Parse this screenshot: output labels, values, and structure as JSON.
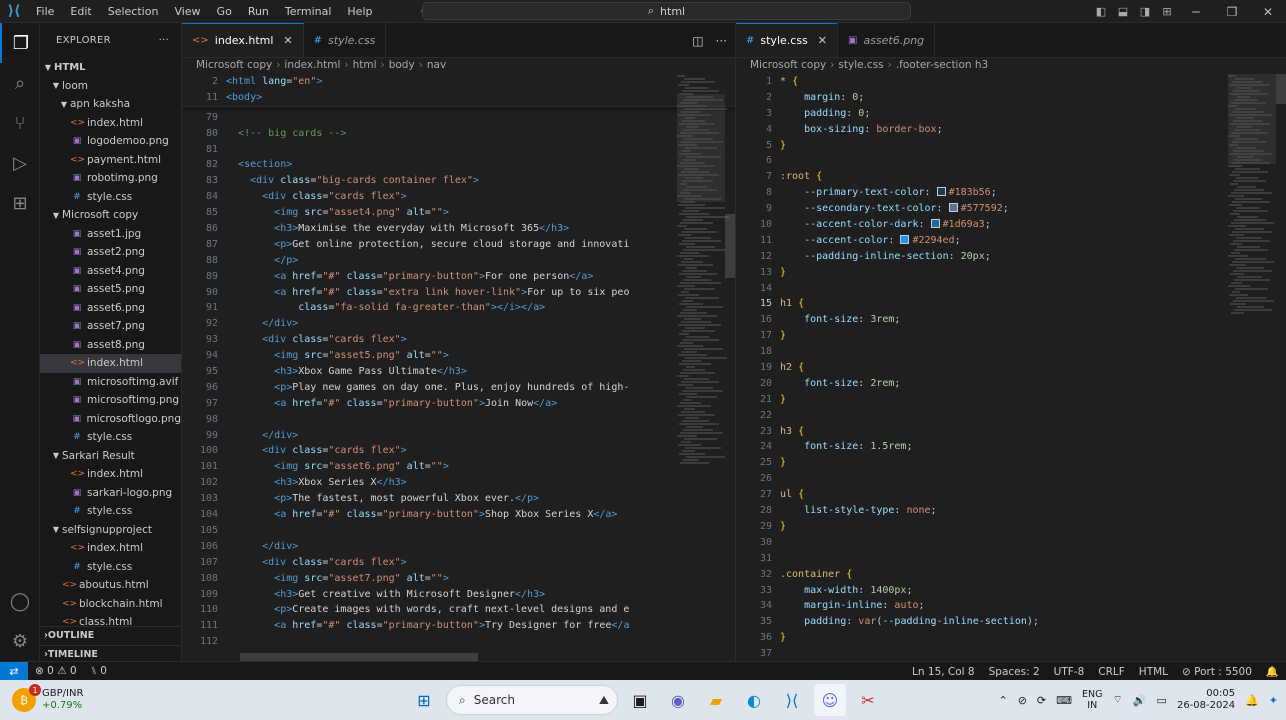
{
  "titlebar": {
    "menu": [
      "File",
      "Edit",
      "Selection",
      "View",
      "Go",
      "Run",
      "Terminal",
      "Help"
    ],
    "search_text": "html"
  },
  "explorer": {
    "title": "EXPLORER",
    "root": "HTML",
    "items": [
      {
        "label": "loom",
        "type": "folder",
        "depth": 1,
        "open": true
      },
      {
        "label": "apn kaksha",
        "type": "folder",
        "depth": 2,
        "open": true
      },
      {
        "label": "index.html",
        "type": "html",
        "depth": 2
      },
      {
        "label": "logodemoo.png",
        "type": "img",
        "depth": 2
      },
      {
        "label": "payment.html",
        "type": "html",
        "depth": 2
      },
      {
        "label": "robotimg.png",
        "type": "img",
        "depth": 2
      },
      {
        "label": "style.css",
        "type": "css",
        "depth": 2
      },
      {
        "label": "Microsoft copy",
        "type": "folder",
        "depth": 1,
        "open": true
      },
      {
        "label": "asset1.jpg",
        "type": "img",
        "depth": 2
      },
      {
        "label": "asset2.png",
        "type": "img",
        "depth": 2
      },
      {
        "label": "asset4.png",
        "type": "img",
        "depth": 2
      },
      {
        "label": "asset5.png",
        "type": "img",
        "depth": 2
      },
      {
        "label": "asset6.png",
        "type": "img",
        "depth": 2
      },
      {
        "label": "asset7.png",
        "type": "img",
        "depth": 2
      },
      {
        "label": "asset8.png",
        "type": "img",
        "depth": 2
      },
      {
        "label": "index.html",
        "type": "html",
        "depth": 2,
        "selected": true
      },
      {
        "label": "microsoftimg.avif",
        "type": "img",
        "depth": 2
      },
      {
        "label": "microsoftimg.png",
        "type": "img",
        "depth": 2
      },
      {
        "label": "microsoftlogo.png",
        "type": "img",
        "depth": 2
      },
      {
        "label": "style.css",
        "type": "css",
        "depth": 2
      },
      {
        "label": "Sarkari Result",
        "type": "folder",
        "depth": 1,
        "open": true
      },
      {
        "label": "index.html",
        "type": "html",
        "depth": 2
      },
      {
        "label": "sarkari-logo.png",
        "type": "img",
        "depth": 2
      },
      {
        "label": "style.css",
        "type": "css",
        "depth": 2
      },
      {
        "label": "selfsignupproject",
        "type": "folder",
        "depth": 1,
        "open": true
      },
      {
        "label": "index.html",
        "type": "html",
        "depth": 2
      },
      {
        "label": "style.css",
        "type": "css",
        "depth": 2
      },
      {
        "label": "aboutus.html",
        "type": "html",
        "depth": 1
      },
      {
        "label": "blockchain.html",
        "type": "html",
        "depth": 1
      },
      {
        "label": "class.html",
        "type": "html",
        "depth": 1
      }
    ],
    "sections": [
      "OUTLINE",
      "TIMELINE"
    ]
  },
  "left_editor": {
    "tabs": [
      {
        "label": "index.html",
        "icon": "<>",
        "active": true
      },
      {
        "label": "style.css",
        "icon": "#",
        "active": false
      }
    ],
    "breadcrumb": [
      "Microsoft copy",
      "index.html",
      "html",
      "body",
      "nav"
    ],
    "sticky": [
      {
        "n": "2",
        "html": "<span class='tok-tag'>&lt;html</span> <span class='tok-attr'>lang</span>=<span class='tok-str'>\"en\"</span><span class='tok-tag'>&gt;</span>"
      },
      {
        "n": "11",
        "html": "<span class='tok-tag'>&lt;body&gt;</span>"
      }
    ],
    "lines": [
      {
        "n": "79",
        "html": ""
      },
      {
        "n": "80",
        "html": "  <span class='tok-cmt'>&lt;!-- big cards --&gt;</span>"
      },
      {
        "n": "81",
        "html": ""
      },
      {
        "n": "82",
        "html": "  <span class='tok-tag'>&lt;section&gt;</span>"
      },
      {
        "n": "83",
        "html": "    <span class='tok-tag'>&lt;div</span> <span class='tok-attr'>class</span>=<span class='tok-str'>\"big-cards container flex\"</span><span class='tok-tag'>&gt;</span>"
      },
      {
        "n": "84",
        "html": "      <span class='tok-tag'>&lt;div</span> <span class='tok-attr'>class</span>=<span class='tok-str'>\"cards flex\"</span><span class='tok-tag'>&gt;</span>"
      },
      {
        "n": "85",
        "html": "        <span class='tok-tag'>&lt;img</span> <span class='tok-attr'>src</span>=<span class='tok-str'>\"asset4.png\"</span> <span class='tok-attr'>alt</span>=<span class='tok-str'>\"\"</span><span class='tok-tag'>&gt;</span>"
      },
      {
        "n": "86",
        "html": "        <span class='tok-tag'>&lt;h3&gt;</span><span class='tok-txt'>Maximise the everyday with Microsoft 365</span><span class='tok-tag'>&lt;/h3&gt;</span>"
      },
      {
        "n": "87",
        "html": "        <span class='tok-tag'>&lt;p&gt;</span><span class='tok-txt'>Get online protection, secure cloud storage and innovati</span>"
      },
      {
        "n": "88",
        "html": "        <span class='tok-tag'>&lt;/p&gt;</span>"
      },
      {
        "n": "89",
        "html": "        <span class='tok-tag'>&lt;a</span> <span class='tok-attr'>href</span>=<span class='tok-str'>\"#\"</span> <span class='tok-attr'>class</span>=<span class='tok-str'>\"primary-button\"</span><span class='tok-tag'>&gt;</span><span class='tok-txt'>For one person</span><span class='tok-tag'>&lt;/a&gt;</span>"
      },
      {
        "n": "90",
        "html": "        <span class='tok-tag'>&lt;a</span> <span class='tok-attr'>href</span>=<span class='tok-str'>\"#\"</span> <span class='tok-attr'>class</span>=<span class='tok-str'>\"extra link hover-link\"</span><span class='tok-tag'>&gt;</span><span class='tok-txt'>For up to six peo</span>"
      },
      {
        "n": "91",
        "html": "            <span class='tok-attr'>class</span>=<span class='tok-str'>\"fa-solid fa-greater-than\"</span><span class='tok-tag'>&gt;&lt;/i&gt;&lt;/a&gt;</span>"
      },
      {
        "n": "92",
        "html": "      <span class='tok-tag'>&lt;/div&gt;</span>"
      },
      {
        "n": "93",
        "html": "      <span class='tok-tag'>&lt;div</span> <span class='tok-attr'>class</span>=<span class='tok-str'>\"cards flex\"</span><span class='tok-tag'>&gt;</span>"
      },
      {
        "n": "94",
        "html": "        <span class='tok-tag'>&lt;img</span> <span class='tok-attr'>src</span>=<span class='tok-str'>\"asset5.png\"</span> <span class='tok-attr'>alt</span>=<span class='tok-str'>\"\"</span><span class='tok-tag'>&gt;</span>"
      },
      {
        "n": "95",
        "html": "        <span class='tok-tag'>&lt;h3&gt;</span><span class='tok-txt'>Xbox Game Pass Ultimate</span><span class='tok-tag'>&lt;/h3&gt;</span>"
      },
      {
        "n": "96",
        "html": "        <span class='tok-tag'>&lt;p&gt;</span><span class='tok-txt'>Play new games on day one. Plus, enjoy hundreds of high-</span>"
      },
      {
        "n": "97",
        "html": "        <span class='tok-tag'>&lt;a</span> <span class='tok-attr'>href</span>=<span class='tok-str'>\"#\"</span> <span class='tok-attr'>class</span>=<span class='tok-str'>\"primary-button\"</span><span class='tok-tag'>&gt;</span><span class='tok-txt'>Join Now</span><span class='tok-tag'>&lt;/a&gt;</span>"
      },
      {
        "n": "98",
        "html": ""
      },
      {
        "n": "99",
        "html": "      <span class='tok-tag'>&lt;/div&gt;</span>"
      },
      {
        "n": "100",
        "html": "      <span class='tok-tag'>&lt;div</span> <span class='tok-attr'>class</span>=<span class='tok-str'>\"cards flex\"</span><span class='tok-tag'>&gt;</span>"
      },
      {
        "n": "101",
        "html": "        <span class='tok-tag'>&lt;img</span> <span class='tok-attr'>src</span>=<span class='tok-str'>\"asset6.png\"</span> <span class='tok-attr'>alt</span>=<span class='tok-str'>\"\"</span><span class='tok-tag'>&gt;</span>"
      },
      {
        "n": "102",
        "html": "        <span class='tok-tag'>&lt;h3&gt;</span><span class='tok-txt'>Xbox Series X</span><span class='tok-tag'>&lt;/h3&gt;</span>"
      },
      {
        "n": "103",
        "html": "        <span class='tok-tag'>&lt;p&gt;</span><span class='tok-txt'>The fastest, most powerful Xbox ever.</span><span class='tok-tag'>&lt;/p&gt;</span>"
      },
      {
        "n": "104",
        "html": "        <span class='tok-tag'>&lt;a</span> <span class='tok-attr'>href</span>=<span class='tok-str'>\"#\"</span> <span class='tok-attr'>class</span>=<span class='tok-str'>\"primary-button\"</span><span class='tok-tag'>&gt;</span><span class='tok-txt'>Shop Xbox Series X</span><span class='tok-tag'>&lt;/a&gt;</span>"
      },
      {
        "n": "105",
        "html": ""
      },
      {
        "n": "106",
        "html": "      <span class='tok-tag'>&lt;/div&gt;</span>"
      },
      {
        "n": "107",
        "html": "      <span class='tok-tag'>&lt;div</span> <span class='tok-attr'>class</span>=<span class='tok-str'>\"cards flex\"</span><span class='tok-tag'>&gt;</span>"
      },
      {
        "n": "108",
        "html": "        <span class='tok-tag'>&lt;img</span> <span class='tok-attr'>src</span>=<span class='tok-str'>\"asset7.png\"</span> <span class='tok-attr'>alt</span>=<span class='tok-str'>\"\"</span><span class='tok-tag'>&gt;</span>"
      },
      {
        "n": "109",
        "html": "        <span class='tok-tag'>&lt;h3&gt;</span><span class='tok-txt'>Get creative with Microsoft Designer</span><span class='tok-tag'>&lt;/h3&gt;</span>"
      },
      {
        "n": "110",
        "html": "        <span class='tok-tag'>&lt;p&gt;</span><span class='tok-txt'>Create images with words, craft next-level designs and e</span>"
      },
      {
        "n": "111",
        "html": "        <span class='tok-tag'>&lt;a</span> <span class='tok-attr'>href</span>=<span class='tok-str'>\"#\"</span> <span class='tok-attr'>class</span>=<span class='tok-str'>\"primary-button\"</span><span class='tok-tag'>&gt;</span><span class='tok-txt'>Try Designer for free</span><span class='tok-tag'>&lt;/a</span>"
      },
      {
        "n": "112",
        "html": ""
      }
    ]
  },
  "right_editor": {
    "tabs": [
      {
        "label": "style.css",
        "icon": "#",
        "active": true
      },
      {
        "label": "asset6.png",
        "icon": "▣",
        "active": false
      }
    ],
    "breadcrumb": [
      "Microsoft copy",
      "style.css",
      ".footer-section h3"
    ],
    "lines": [
      {
        "n": "1",
        "html": "<span class='tok-sel'>*</span> <span class='tok-brace'>{</span>"
      },
      {
        "n": "2",
        "html": "    <span class='tok-prop'>margin</span>: <span class='tok-num'>0</span>;"
      },
      {
        "n": "3",
        "html": "    <span class='tok-prop'>padding</span>: <span class='tok-num'>0</span>;"
      },
      {
        "n": "4",
        "html": "    <span class='tok-prop'>box-sizing</span>: <span class='tok-str'>border-box</span>;"
      },
      {
        "n": "5",
        "html": "<span class='tok-brace'>}</span>"
      },
      {
        "n": "6",
        "html": ""
      },
      {
        "n": "7",
        "html": "<span class='tok-sel'>:root</span> <span class='tok-brace'>{</span>"
      },
      {
        "n": "8",
        "html": "    <span class='tok-prop'>--primary-text-color</span>: <span class='swatch' style='background:#183b56'></span><span class='tok-str'>#183b56</span>;"
      },
      {
        "n": "9",
        "html": "    <span class='tok-prop'>--secondary-text-color</span>: <span class='swatch' style='background:#577592'></span><span class='tok-str'>#577592</span>;"
      },
      {
        "n": "10",
        "html": "    <span class='tok-prop'>--accent-color-dark</span>: <span class='swatch' style='background:#1d69a3'></span><span class='tok-str'>#1d69a3</span>;"
      },
      {
        "n": "11",
        "html": "    <span class='tok-prop'>--accent-color</span>: <span class='swatch' style='background:#2294ed'></span><span class='tok-str'>#2294ed</span>;"
      },
      {
        "n": "12",
        "html": "    <span class='tok-prop'>--padding-inline-section</span>: <span class='tok-num'>20px</span>;"
      },
      {
        "n": "13",
        "html": "<span class='tok-brace'>}</span>"
      },
      {
        "n": "14",
        "html": ""
      },
      {
        "n": "15",
        "html": "<span class='tok-sel'>h1</span> <span class='tok-brace'>{</span>"
      },
      {
        "n": "16",
        "html": "    <span class='tok-prop'>font-size</span>: <span class='tok-num'>3rem</span>;"
      },
      {
        "n": "17",
        "html": "<span class='tok-brace'>}</span>"
      },
      {
        "n": "18",
        "html": ""
      },
      {
        "n": "19",
        "html": "<span class='tok-sel'>h2</span> <span class='tok-brace'>{</span>"
      },
      {
        "n": "20",
        "html": "    <span class='tok-prop'>font-size</span>: <span class='tok-num'>2rem</span>;"
      },
      {
        "n": "21",
        "html": "<span class='tok-brace'>}</span>"
      },
      {
        "n": "22",
        "html": ""
      },
      {
        "n": "23",
        "html": "<span class='tok-sel'>h3</span> <span class='tok-brace'>{</span>"
      },
      {
        "n": "24",
        "html": "    <span class='tok-prop'>font-size</span>: <span class='tok-num'>1.5rem</span>;"
      },
      {
        "n": "25",
        "html": "<span class='tok-brace'>}</span>"
      },
      {
        "n": "26",
        "html": ""
      },
      {
        "n": "27",
        "html": "<span class='tok-sel'>ul</span> <span class='tok-brace'>{</span>"
      },
      {
        "n": "28",
        "html": "    <span class='tok-prop'>list-style-type</span>: <span class='tok-str'>none</span>;"
      },
      {
        "n": "29",
        "html": "<span class='tok-brace'>}</span>"
      },
      {
        "n": "30",
        "html": ""
      },
      {
        "n": "31",
        "html": ""
      },
      {
        "n": "32",
        "html": "<span class='tok-sel'>.container</span> <span class='tok-brace'>{</span>"
      },
      {
        "n": "33",
        "html": "    <span class='tok-prop'>max-width</span>: <span class='tok-num'>1400px</span>;"
      },
      {
        "n": "34",
        "html": "    <span class='tok-prop'>margin-inline</span>: <span class='tok-str'>auto</span>;"
      },
      {
        "n": "35",
        "html": "    <span class='tok-prop'>padding</span>: <span class='tok-str'>var</span>(<span class='tok-prop'>--padding-inline-section</span>);"
      },
      {
        "n": "36",
        "html": "<span class='tok-brace'>}</span>"
      },
      {
        "n": "37",
        "html": ""
      }
    ]
  },
  "statusbar": {
    "errors": "0",
    "warnings": "0",
    "ports": "0",
    "cursor": "Ln 15, Col 8",
    "spaces": "Spaces: 2",
    "encoding": "UTF-8",
    "eol": "CRLF",
    "language": "HTML",
    "port": "Port : 5500"
  },
  "taskbar": {
    "widget_title": "GBP/INR",
    "widget_value": "+0.79%",
    "widget_badge": "1",
    "search": "Search",
    "lang_top": "ENG",
    "lang_bottom": "IN",
    "time": "00:05",
    "date": "26-08-2024"
  }
}
